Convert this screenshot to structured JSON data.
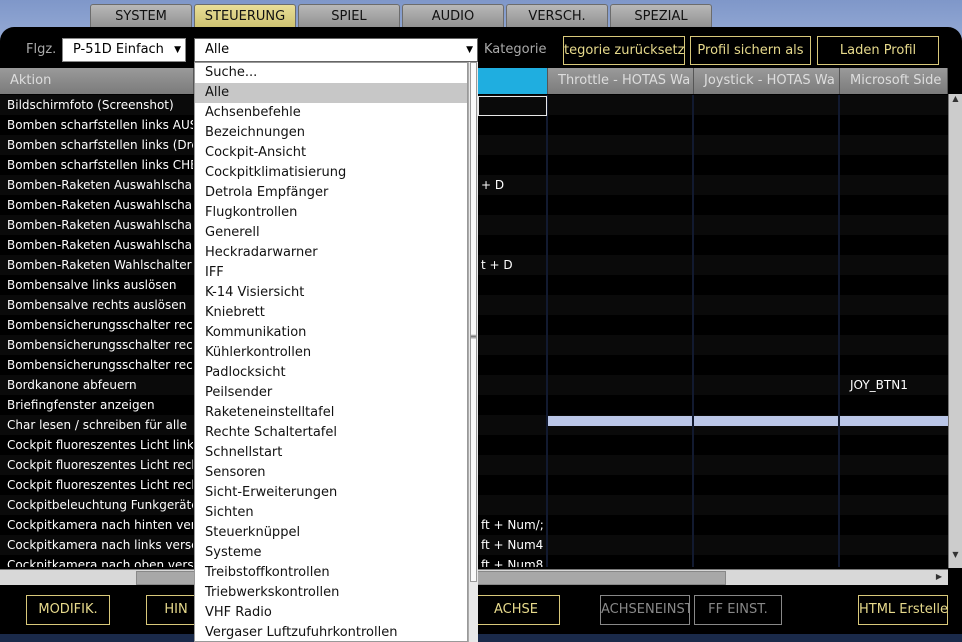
{
  "tabs": [
    {
      "label": "SYSTEM",
      "active": false
    },
    {
      "label": "STEUERUNG",
      "active": true
    },
    {
      "label": "SPIEL",
      "active": false
    },
    {
      "label": "AUDIO",
      "active": false
    },
    {
      "label": "VERSCH.",
      "active": false
    },
    {
      "label": "SPEZIAL",
      "active": false
    }
  ],
  "toolbar": {
    "aircraft_label": "Flgz.",
    "aircraft_value": "P-51D Einfach",
    "category_value": "Alle",
    "category_label": "Kategorie",
    "reset_category": "tegorie zurücksetz",
    "save_profile": "Profil sichern als",
    "load_profile": "Laden Profil"
  },
  "columns": [
    "Aktion",
    "",
    "Throttle - HOTAS Wa",
    "Joystick - HOTAS Wa",
    "Microsoft Side"
  ],
  "rows": [
    {
      "action": "Bildschirmfoto (Screenshot)",
      "kb": "",
      "ms": ""
    },
    {
      "action": "Bomben scharfstellen  links AUS",
      "kb": "",
      "ms": ""
    },
    {
      "action": "Bomben scharfstellen links (Drehs",
      "kb": "",
      "ms": ""
    },
    {
      "action": "Bomben scharfstellen links CHEMI",
      "kb": "",
      "ms": ""
    },
    {
      "action": "Bomben-Raketen Auswahlschalte",
      "kb": "+ D",
      "ms": ""
    },
    {
      "action": "Bomben-Raketen Auswahlschalte",
      "kb": "",
      "ms": ""
    },
    {
      "action": "Bomben-Raketen Auswahlschalte",
      "kb": "",
      "ms": ""
    },
    {
      "action": "Bomben-Raketen Auswahlschalte",
      "kb": "",
      "ms": ""
    },
    {
      "action": "Bomben-Raketen Wahlschalter SA",
      "kb": "t + D",
      "ms": ""
    },
    {
      "action": "Bombensalve links auslösen",
      "kb": "",
      "ms": ""
    },
    {
      "action": "Bombensalve rechts auslösen",
      "kb": "",
      "ms": ""
    },
    {
      "action": "Bombensicherungsschalter rechts",
      "kb": "",
      "ms": ""
    },
    {
      "action": "Bombensicherungsschalter rechts",
      "kb": "",
      "ms": ""
    },
    {
      "action": "Bombensicherungsschalter rechts",
      "kb": "",
      "ms": ""
    },
    {
      "action": "Bordkanone abfeuern",
      "kb": "",
      "ms": "JOY_BTN1"
    },
    {
      "action": "Briefingfenster anzeigen",
      "kb": "",
      "ms": ""
    },
    {
      "action": "Char lesen / schreiben für alle",
      "kb": "",
      "ms": ""
    },
    {
      "action": "Cockpit fluoreszentes Licht links e",
      "kb": "",
      "ms": ""
    },
    {
      "action": "Cockpit fluoreszentes Licht rechts",
      "kb": "",
      "ms": ""
    },
    {
      "action": "Cockpit fluoreszentes Licht rechts",
      "kb": "",
      "ms": ""
    },
    {
      "action": "Cockpitbeleuchtung Funkgeräte e",
      "kb": "",
      "ms": ""
    },
    {
      "action": "Cockpitkamera nach hinten versch",
      "kb": "ft + Num/; R",
      "ms": ""
    },
    {
      "action": "Cockpitkamera nach links verschie",
      "kb": "ft + Num4",
      "ms": ""
    },
    {
      "action": "Cockpitkamera nach oben verschi",
      "kb": "ft + Num8",
      "ms": ""
    }
  ],
  "dropdown_items": [
    "Suche...",
    "Alle",
    "Achsenbefehle",
    "Bezeichnungen",
    "Cockpit-Ansicht",
    "Cockpitklimatisierung",
    "Detrola Empfänger",
    "Flugkontrollen",
    "Generell",
    "Heckradarwarner",
    "IFF",
    "K-14 Visiersicht",
    "Kniebrett",
    "Kommunikation",
    "Kühlerkontrollen",
    "Padlocksicht",
    "Peilsender",
    "Raketeneinstelltafel",
    "Rechte Schaltertafel",
    "Schnellstart",
    "Sensoren",
    "Sicht-Erweiterungen",
    "Sichten",
    "Steuerknüppel",
    "Systeme",
    "Treibstoffkontrollen",
    "Triebwerkskontrollen",
    "VHF Radio",
    "Vergaser Luftzufuhrkontrollen"
  ],
  "dropdown_highlight": 1,
  "bottom": {
    "modifiers": "MODIFIK.",
    "hints": "HIN",
    "axis": "ACHSE",
    "axis_settings": "ACHSENEINST",
    "ff_settings": "FF EINST.",
    "html_create": "HTML Ersteller"
  },
  "colors": {
    "accent": "#e7da8c",
    "active_tab": "#d8cc7e",
    "header_selected": "#1faee0"
  }
}
